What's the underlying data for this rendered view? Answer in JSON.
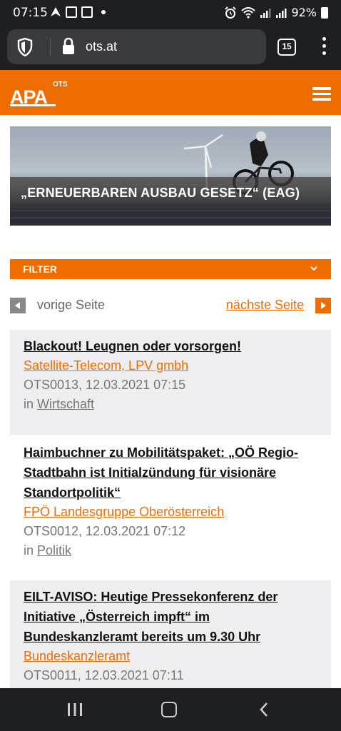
{
  "status": {
    "time": "07:15",
    "battery": "92%"
  },
  "browser": {
    "url": "ots.at",
    "tab_count": "15"
  },
  "site": {
    "logo_text": "APA",
    "logo_sub": "OTS"
  },
  "hero": {
    "caption": "„ERNEUERBAREN AUSBAU GESETZ“ (EAG)"
  },
  "filter": {
    "label": "FILTER"
  },
  "pager": {
    "prev": "vorige Seite",
    "next": "nächste Seite"
  },
  "articles": [
    {
      "title": "Blackout! Leugnen oder vorsorgen!",
      "source": "Satellite-Telecom, LPV gmbh",
      "meta": "OTS0013, 12.03.2021 07:15",
      "cat_prefix": "in",
      "category": "Wirtschaft"
    },
    {
      "title": "Haimbuchner zu Mobilitätspaket: „OÖ Regio-Stadtbahn ist Initialzündung für visionäre Standortpolitik“",
      "source": "FPÖ Landesgruppe Oberösterreich",
      "meta": "OTS0012, 12.03.2021 07:12",
      "cat_prefix": "in",
      "category": "Politik"
    },
    {
      "title": "EILT-AVISO: Heutige Pressekonferenz der Initiative „Österreich impft“ im Bundeskanzleramt bereits um 9.30 Uhr",
      "source": "Bundeskanzleramt",
      "meta": "OTS0011, 12.03.2021 07:11"
    }
  ],
  "colors": {
    "accent": "#ef6c00",
    "chrome": "#1e1f22"
  }
}
